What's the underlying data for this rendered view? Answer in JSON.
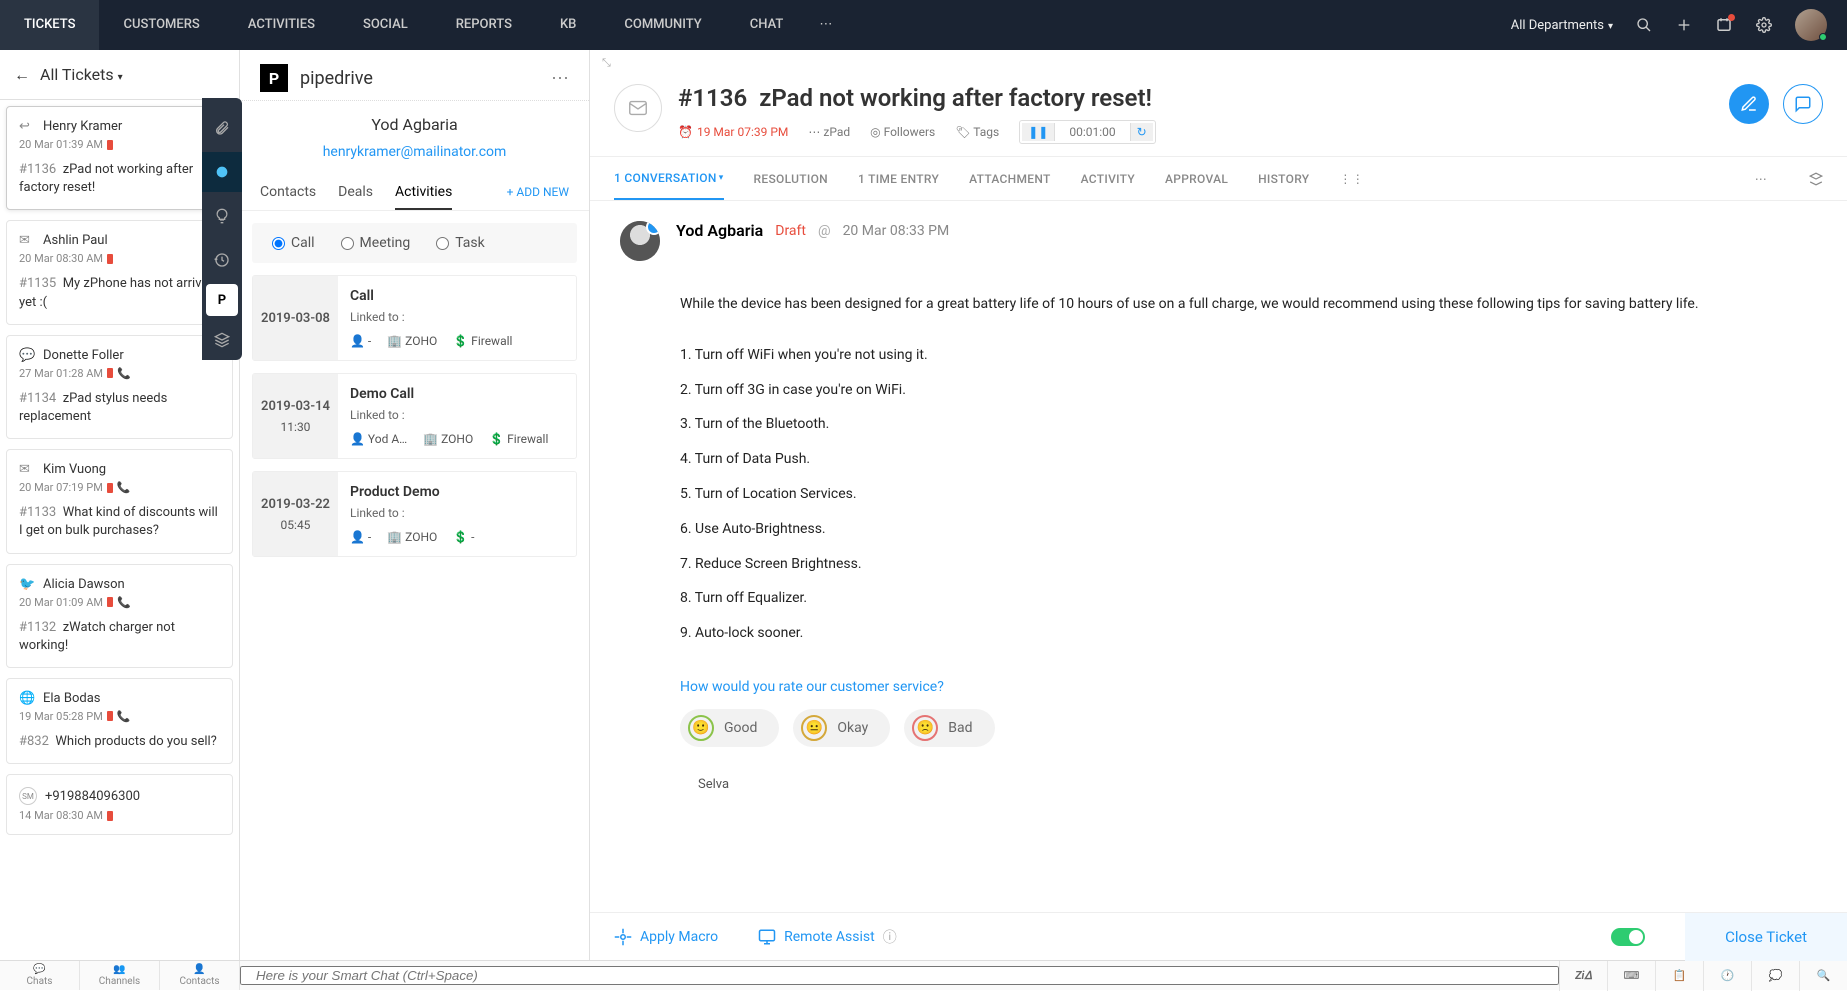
{
  "topnav": {
    "items": [
      "TICKETS",
      "CUSTOMERS",
      "ACTIVITIES",
      "SOCIAL",
      "REPORTS",
      "KB",
      "COMMUNITY",
      "CHAT"
    ],
    "active": 0,
    "dept_label": "All Departments"
  },
  "ticket_list": {
    "header": "All Tickets",
    "items": [
      {
        "icon": "reply",
        "name": "Henry Kramer",
        "time": "20 Mar 01:39 AM",
        "overdue": true,
        "id": "#1136",
        "subject": "zPad not working after factory reset!",
        "selected": true
      },
      {
        "icon": "mail",
        "name": "Ashlin Paul",
        "time": "20 Mar 08:30 AM",
        "overdue": true,
        "id": "#1135",
        "subject": "My zPhone has not arrived yet :("
      },
      {
        "icon": "chat",
        "name": "Donette Foller",
        "time": "27 Mar 01:28 AM",
        "overdue": true,
        "phone": true,
        "id": "#1134",
        "subject": "zPad stylus needs replacement"
      },
      {
        "icon": "mail",
        "name": "Kim Vuong",
        "time": "20 Mar 07:19 PM",
        "overdue": true,
        "phone": true,
        "id": "#1133",
        "subject": "What kind of discounts will I get on bulk purchases?"
      },
      {
        "icon": "twitter",
        "name": "Alicia Dawson",
        "time": "20 Mar 01:09 AM",
        "overdue": true,
        "phone": true,
        "id": "#1132",
        "subject": "zWatch charger not working!"
      },
      {
        "icon": "web",
        "name": "Ela Bodas",
        "time": "19 Mar 05:28 PM",
        "overdue": true,
        "phone": true,
        "id": "#832",
        "subject": "Which products do you sell?"
      },
      {
        "icon": "initials",
        "initials": "SM",
        "name": "+919884096300",
        "time": "14 Mar 08:30 AM",
        "overdue": true,
        "id": "",
        "subject": ""
      }
    ]
  },
  "pipedrive": {
    "title": "pipedrive",
    "contact_name": "Yod Agbaria",
    "contact_email": "henrykramer@mailinator.com",
    "tabs": [
      "Contacts",
      "Deals",
      "Activities"
    ],
    "active_tab": 2,
    "addnew": "+ ADD NEW",
    "types": [
      "Call",
      "Meeting",
      "Task"
    ],
    "selected_type": 0,
    "activities": [
      {
        "date": "2019-03-08",
        "time": "",
        "title": "Call",
        "linked": "Linked to :",
        "person": "-",
        "org": "ZOHO",
        "deal": "Firewall"
      },
      {
        "date": "2019-03-14",
        "time": "11:30",
        "title": "Demo Call",
        "linked": "Linked to :",
        "person": "Yod A…",
        "org": "ZOHO",
        "deal": "Firewall"
      },
      {
        "date": "2019-03-22",
        "time": "05:45",
        "title": "Product Demo",
        "linked": "Linked to :",
        "person": "-",
        "org": "ZOHO",
        "deal": "-"
      }
    ]
  },
  "ticket": {
    "id": "#1136",
    "title": "zPad not working after factory reset!",
    "timestamp": "19 Mar 07:39 PM",
    "product": "zPad",
    "followers_label": "Followers",
    "tags_label": "Tags",
    "timer": "00:01:00",
    "tabs": [
      {
        "label": "1 CONVERSATION",
        "active": true,
        "dropdown": true
      },
      {
        "label": "RESOLUTION"
      },
      {
        "label": "1 TIME ENTRY"
      },
      {
        "label": "ATTACHMENT"
      },
      {
        "label": "ACTIVITY"
      },
      {
        "label": "APPROVAL"
      },
      {
        "label": "HISTORY"
      }
    ]
  },
  "conversation": {
    "author": "Yod Agbaria",
    "draft": "Draft",
    "at": "@",
    "ts": "20 Mar 08:33 PM",
    "intro": "While the device has been designed for a great battery life of 10 hours of use on a full charge, we would recommend using these following tips for saving battery life.",
    "points": [
      "1. Turn off WiFi when you're not using it.",
      "2. Turn off 3G in case you're on WiFi.",
      "3. Turn of the Bluetooth.",
      "4. Turn of Data Push.",
      "5. Turn of Location Services.",
      "6. Use Auto-Brightness.",
      "7. Reduce Screen Brightness.",
      "8. Turn off Equalizer.",
      "9. Auto-lock sooner."
    ],
    "rate_q": "How would you rate our customer service?",
    "rate_options": [
      "Good",
      "Okay",
      "Bad"
    ],
    "signature": "Selva"
  },
  "footer": {
    "apply_macro": "Apply Macro",
    "remote_assist": "Remote Assist",
    "close": "Close Ticket"
  },
  "bottombar": {
    "cols": [
      "Chats",
      "Channels",
      "Contacts"
    ],
    "smartchat_placeholder": "Here is your Smart Chat (Ctrl+Space)"
  }
}
